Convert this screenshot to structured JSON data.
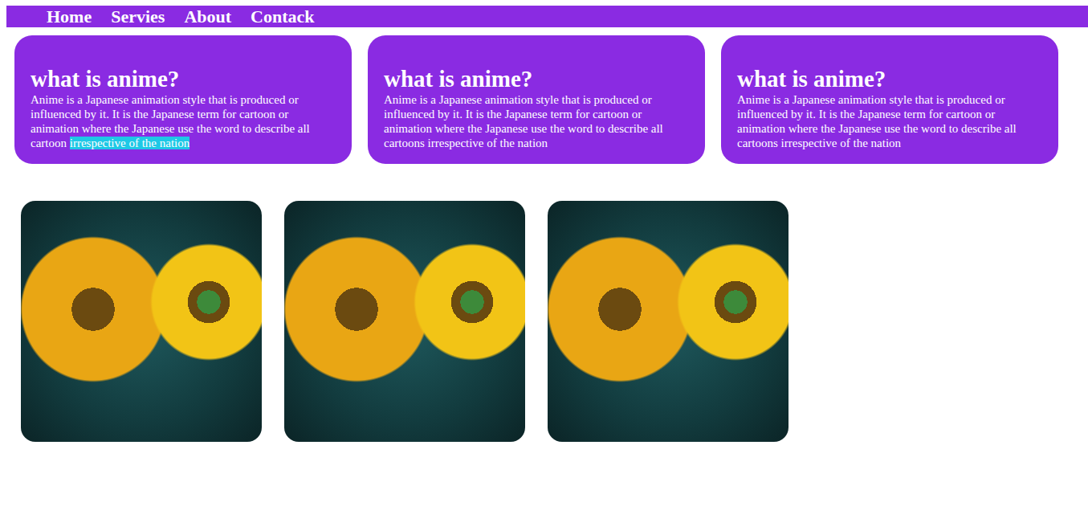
{
  "nav": {
    "items": [
      "Home",
      "Servies",
      "About",
      "Contack"
    ]
  },
  "cards": [
    {
      "title": "what is anime?",
      "body": [
        {
          "text": "Anime is a Japanese animation style that is produced or influenced by it. It is the Japanese term for cartoon or animation where the Japanese use the word to describe all cartoon ",
          "selected": false
        },
        {
          "text": "irrespective of the nation",
          "selected": true
        }
      ]
    },
    {
      "title": "what is anime?",
      "body": [
        {
          "text": "Anime is a Japanese animation style that is produced or influenced by it. It is the Japanese term for cartoon or animation where the Japanese use the word to describe all cartoons irrespective of the nation",
          "selected": false
        }
      ]
    },
    {
      "title": "what is anime?",
      "body": [
        {
          "text": "Anime is a Japanese animation style that is produced or influenced by it. It is the Japanese term for cartoon or animation where the Japanese use the word to describe all cartoons irrespective of the nation",
          "selected": false
        }
      ]
    }
  ],
  "photos": [
    {
      "kind": "photo"
    },
    {
      "kind": "photo"
    },
    {
      "kind": "photo"
    }
  ]
}
